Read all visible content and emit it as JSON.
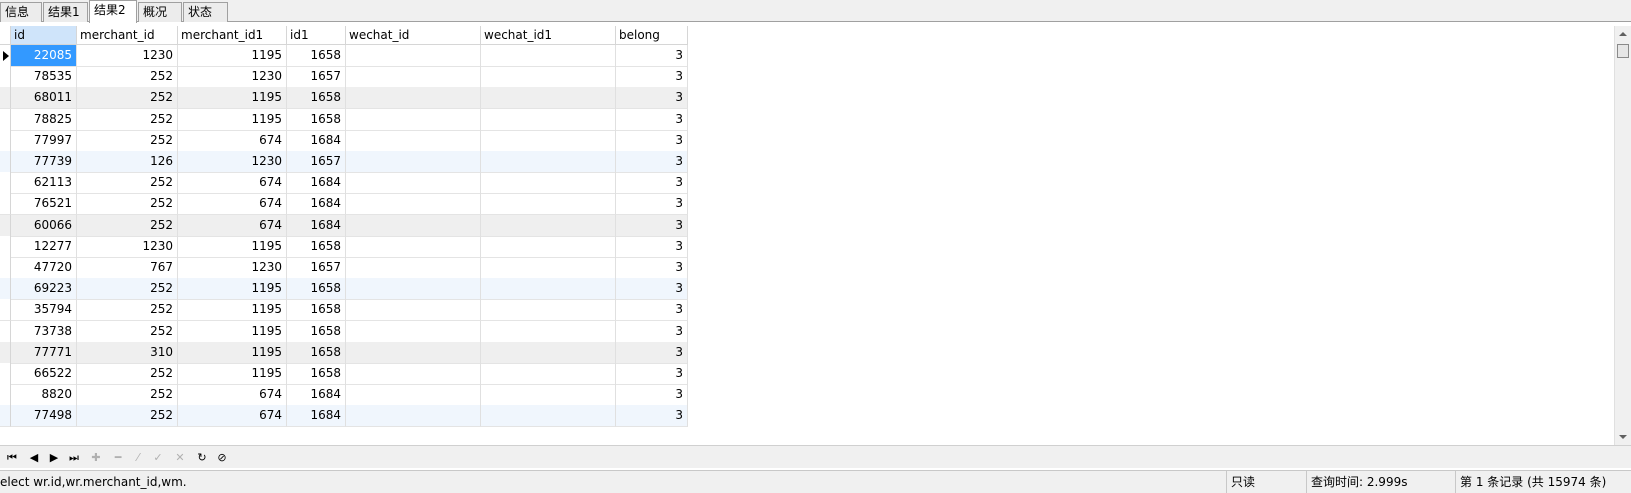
{
  "tabs": [
    {
      "label": "信息"
    },
    {
      "label": "结果1"
    },
    {
      "label": "结果2"
    },
    {
      "label": "概况"
    },
    {
      "label": "状态"
    }
  ],
  "active_tab": 2,
  "grid": {
    "columns": [
      "id",
      "merchant_id",
      "merchant_id1",
      "id1",
      "wechat_id",
      "wechat_id1",
      "belong"
    ],
    "rows": [
      [
        "22085",
        "1230",
        "1195",
        "1658",
        "",
        "",
        "3"
      ],
      [
        "78535",
        "252",
        "1230",
        "1657",
        "",
        "",
        "3"
      ],
      [
        "68011",
        "252",
        "1195",
        "1658",
        "",
        "",
        "3"
      ],
      [
        "78825",
        "252",
        "1195",
        "1658",
        "",
        "",
        "3"
      ],
      [
        "77997",
        "252",
        "674",
        "1684",
        "",
        "",
        "3"
      ],
      [
        "77739",
        "126",
        "1230",
        "1657",
        "",
        "",
        "3"
      ],
      [
        "62113",
        "252",
        "674",
        "1684",
        "",
        "",
        "3"
      ],
      [
        "76521",
        "252",
        "674",
        "1684",
        "",
        "",
        "3"
      ],
      [
        "60066",
        "252",
        "674",
        "1684",
        "",
        "",
        "3"
      ],
      [
        "12277",
        "1230",
        "1195",
        "1658",
        "",
        "",
        "3"
      ],
      [
        "47720",
        "767",
        "1230",
        "1657",
        "",
        "",
        "3"
      ],
      [
        "69223",
        "252",
        "1195",
        "1658",
        "",
        "",
        "3"
      ],
      [
        "35794",
        "252",
        "1195",
        "1658",
        "",
        "",
        "3"
      ],
      [
        "73738",
        "252",
        "1195",
        "1658",
        "",
        "",
        "3"
      ],
      [
        "77771",
        "310",
        "1195",
        "1658",
        "",
        "",
        "3"
      ],
      [
        "66522",
        "252",
        "1195",
        "1658",
        "",
        "",
        "3"
      ],
      [
        "8820",
        "252",
        "674",
        "1684",
        "",
        "",
        "3"
      ],
      [
        "77498",
        "252",
        "674",
        "1684",
        "",
        "",
        "3"
      ]
    ],
    "row_shading": [
      "none",
      "none",
      "gray",
      "none",
      "none",
      "blue",
      "none",
      "none",
      "gray",
      "none",
      "none",
      "blue",
      "none",
      "none",
      "gray",
      "none",
      "none",
      "blue"
    ]
  },
  "nav_buttons": [
    {
      "name": "first-record-button",
      "glyph": "⏮",
      "enabled": true
    },
    {
      "name": "prev-record-button",
      "glyph": "◀",
      "enabled": true
    },
    {
      "name": "next-record-button",
      "glyph": "▶",
      "enabled": true
    },
    {
      "name": "last-record-button",
      "glyph": "⏭",
      "enabled": true
    },
    {
      "name": "add-record-button",
      "glyph": "✚",
      "enabled": false
    },
    {
      "name": "delete-record-button",
      "glyph": "━",
      "enabled": false
    },
    {
      "name": "edit-record-button",
      "glyph": "⁄",
      "enabled": false
    },
    {
      "name": "apply-changes-button",
      "glyph": "✓",
      "enabled": false
    },
    {
      "name": "discard-changes-button",
      "glyph": "✕",
      "enabled": false
    },
    {
      "name": "refresh-button",
      "glyph": "↻",
      "enabled": true
    },
    {
      "name": "stop-button",
      "glyph": "⊘",
      "enabled": true
    }
  ],
  "status": {
    "sql": "elect wr.id,wr.merchant_id,wm.",
    "mode": "只读",
    "query_time": "查询时间: 2.999s",
    "record_info": "第 1 条记录 (共 15974 条)"
  }
}
